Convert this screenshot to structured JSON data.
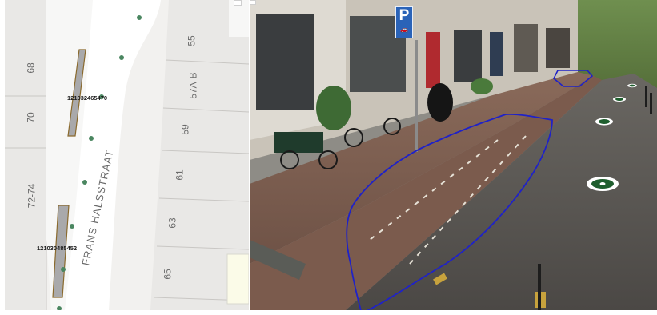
{
  "map": {
    "house_numbers_left": [
      "68",
      "70",
      "72-74"
    ],
    "house_numbers_right": [
      "55",
      "57A-B",
      "59",
      "61",
      "63",
      "65"
    ],
    "street_name": "FRANS HALSSTRAAT",
    "object_ids": [
      "121032465470",
      "121030485452"
    ],
    "colors": {
      "building": "#e9e8e6",
      "building_line": "#c9c7c4",
      "sidewalk": "#f7f7f6",
      "street": "#ffffff",
      "parking_strip": "#a9a9ab",
      "parking_outline": "#8a6a2e",
      "tree_dot": "#4a8660"
    }
  },
  "streetview": {
    "sign_letter": "P",
    "sign_icon": "car-icon",
    "colors": {
      "annotation_outline": "#1f22c8",
      "marker_ring": "#ffffff",
      "marker_fill": "#1f5e2e"
    }
  }
}
